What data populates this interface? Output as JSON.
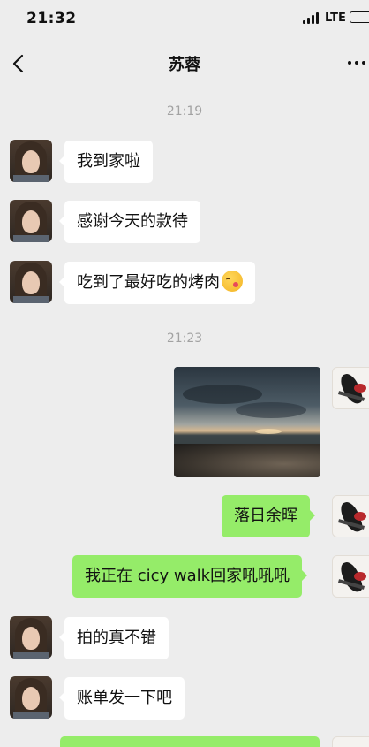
{
  "status_bar": {
    "time": "21:32",
    "network": "LTE"
  },
  "header": {
    "title": "苏蓉"
  },
  "messages": {
    "ts1": "21:19",
    "m1": "我到家啦",
    "m2": "感谢今天的款待",
    "m3": "吃到了最好吃的烤肉",
    "ts2": "21:23",
    "m4": "落日余晖",
    "m5": "我正在 cicy walk回家吼吼吼",
    "m6": "拍的真不错",
    "m7": "账单发一下吧"
  },
  "icons": {
    "back": "chevron-left-icon",
    "more": "more-dots-icon",
    "emoji": "wink-tongue-emoji-icon"
  },
  "colors": {
    "background": "#ededed",
    "outgoing_bubble": "#95ec69",
    "incoming_bubble": "#ffffff",
    "timestamp": "#a2a2a2"
  }
}
